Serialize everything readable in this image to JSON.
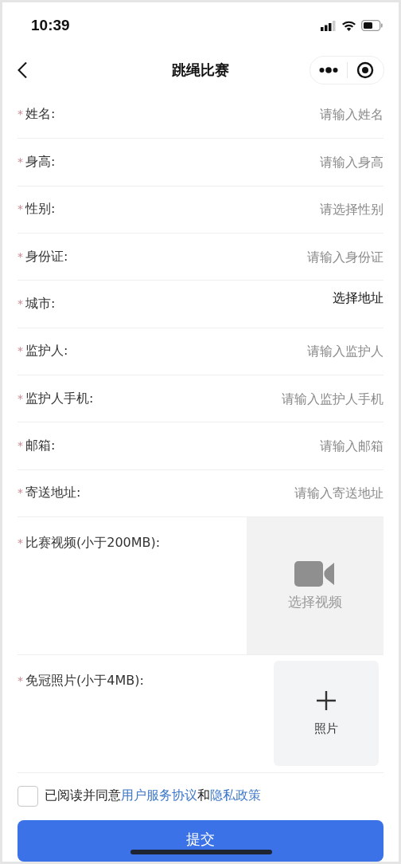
{
  "status_bar": {
    "time": "10:39"
  },
  "nav": {
    "title": "跳绳比赛"
  },
  "fields": [
    {
      "required_mark": "*",
      "label": "姓名:",
      "kind": "input",
      "placeholder": "请输入姓名"
    },
    {
      "required_mark": "*",
      "label": "身高:",
      "kind": "input",
      "placeholder": "请输入身高"
    },
    {
      "required_mark": "*",
      "label": "性别:",
      "kind": "input",
      "placeholder": "请选择性别"
    },
    {
      "required_mark": "*",
      "label": "身份证:",
      "kind": "input",
      "placeholder": "请输入身份证"
    },
    {
      "required_mark": "*",
      "label": "城市:",
      "kind": "picker",
      "value": "选择地址"
    },
    {
      "required_mark": "*",
      "label": "监护人:",
      "kind": "input",
      "placeholder": "请输入监护人"
    },
    {
      "required_mark": "*",
      "label": "监护人手机:",
      "kind": "input",
      "placeholder": "请输入监护人手机"
    },
    {
      "required_mark": "*",
      "label": "邮箱:",
      "kind": "input",
      "placeholder": "请输入邮箱"
    },
    {
      "required_mark": "*",
      "label": "寄送地址:",
      "kind": "input",
      "placeholder": "请输入寄送地址"
    }
  ],
  "uploads": [
    {
      "required_mark": "*",
      "label": "比赛视频(小于200MB):",
      "kind": "video",
      "button": "选择视频"
    },
    {
      "required_mark": "*",
      "label": "免冠照片(小于4MB):",
      "kind": "photo",
      "button": "照片"
    }
  ],
  "agreement": {
    "checked": false,
    "parts": [
      {
        "kind": "text",
        "text": "已阅读并同意"
      },
      {
        "kind": "link",
        "text": "用户服务协议"
      },
      {
        "kind": "text",
        "text": "和"
      },
      {
        "kind": "link",
        "text": "隐私政策"
      }
    ]
  },
  "submit": {
    "label": "提交"
  }
}
